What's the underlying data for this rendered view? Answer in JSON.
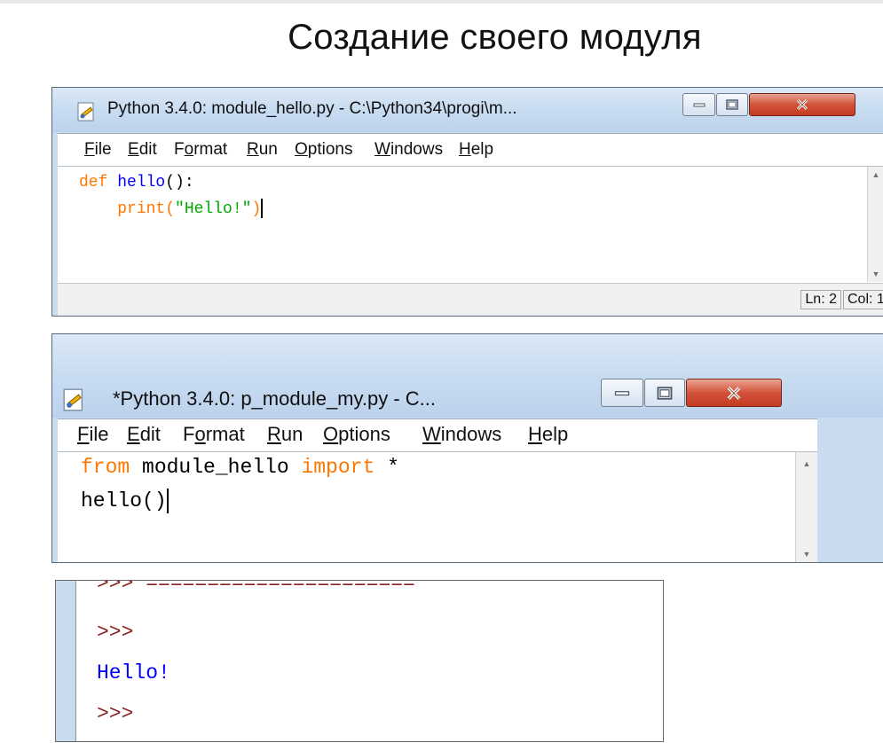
{
  "slide": {
    "title": "Создание своего модуля"
  },
  "window1": {
    "title": "Python 3.4.0: module_hello.py - C:\\Python34\\progi\\m...",
    "menu": [
      {
        "label": "File",
        "u": 0
      },
      {
        "label": "Edit",
        "u": 0
      },
      {
        "label": "Format",
        "u": 1
      },
      {
        "label": "Run",
        "u": 0
      },
      {
        "label": "Options",
        "u": 0
      },
      {
        "label": "Windows",
        "u": 0
      },
      {
        "label": "Help",
        "u": 0
      }
    ],
    "code": {
      "line1_kw": "def",
      "line1_fn": "hello",
      "line1_rest": "():",
      "line2_indent": "    ",
      "line2_call": "print(",
      "line2_str": "\"Hello!\"",
      "line2_close": ")"
    },
    "status": {
      "ln": "Ln: 2",
      "col": "Col: 1"
    }
  },
  "window2": {
    "title": "*Python 3.4.0: p_module_my.py - C...",
    "menu": [
      {
        "label": "File",
        "u": 0
      },
      {
        "label": "Edit",
        "u": 0
      },
      {
        "label": "Format",
        "u": 1
      },
      {
        "label": "Run",
        "u": 0
      },
      {
        "label": "Options",
        "u": 0
      },
      {
        "label": "Windows",
        "u": 0
      },
      {
        "label": "Help",
        "u": 0
      }
    ],
    "code": {
      "line1_from": "from",
      "line1_module": " module_hello ",
      "line1_import": "import",
      "line1_star": " *",
      "line2": "hello()"
    }
  },
  "shell": {
    "separator": ">>> ======================",
    "prompt1": ">>>",
    "output": "Hello!",
    "prompt2": ">>>"
  },
  "colors": {
    "keyword": "#ff7700",
    "definition": "#0000ff",
    "string": "#00aa00",
    "prompt": "#882222",
    "stdout": "#0000ff",
    "window_frame": "#c9dbee",
    "close_button": "#c33b22"
  },
  "icons": [
    "idle-app-icon",
    "minimize-icon",
    "maximize-icon",
    "close-icon",
    "scroll-up-icon",
    "scroll-down-icon"
  ]
}
